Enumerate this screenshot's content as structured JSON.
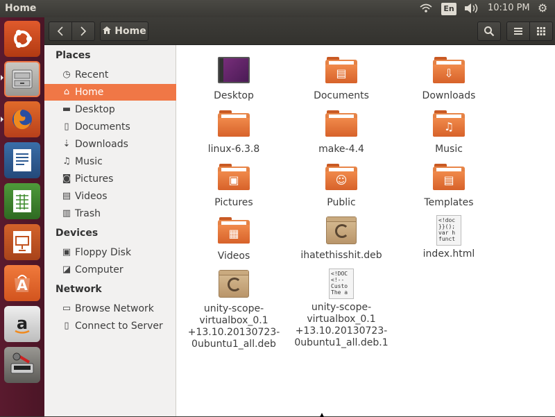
{
  "topbar": {
    "title": "Home",
    "language": "En",
    "clock": "10:10 PM",
    "icons": {
      "network": "wifi-icon",
      "sound": "volume-icon",
      "system": "gear-icon"
    }
  },
  "launcher": {
    "items": [
      {
        "name": "ubuntu-dash-icon",
        "glyph": "◎"
      },
      {
        "name": "files-icon",
        "glyph": "▭"
      },
      {
        "name": "firefox-icon",
        "glyph": "●"
      },
      {
        "name": "libreoffice-writer-icon",
        "glyph": "≡"
      },
      {
        "name": "libreoffice-calc-icon",
        "glyph": "▦"
      },
      {
        "name": "libreoffice-impress-icon",
        "glyph": "▣"
      },
      {
        "name": "software-center-icon",
        "glyph": "A"
      },
      {
        "name": "amazon-icon",
        "glyph": "a"
      },
      {
        "name": "system-settings-icon",
        "glyph": "⚙"
      }
    ]
  },
  "headerbar": {
    "location": "Home",
    "icons": {
      "back": "‹",
      "forward": "›",
      "home": "⌂",
      "search": "⚲",
      "menu": "☰",
      "view": "⋮⋮"
    }
  },
  "sidebar": {
    "sections": [
      {
        "title": "Places",
        "items": [
          {
            "label": "Recent",
            "icon": "◷"
          },
          {
            "label": "Home",
            "icon": "⌂",
            "active": true
          },
          {
            "label": "Desktop",
            "icon": "▬"
          },
          {
            "label": "Documents",
            "icon": "▯"
          },
          {
            "label": "Downloads",
            "icon": "⇣"
          },
          {
            "label": "Music",
            "icon": "♫"
          },
          {
            "label": "Pictures",
            "icon": "◙"
          },
          {
            "label": "Videos",
            "icon": "▤"
          },
          {
            "label": "Trash",
            "icon": "▥"
          }
        ]
      },
      {
        "title": "Devices",
        "items": [
          {
            "label": "Floppy Disk",
            "icon": "▣"
          },
          {
            "label": "Computer",
            "icon": "◪"
          }
        ]
      },
      {
        "title": "Network",
        "items": [
          {
            "label": "Browse Network",
            "icon": "▭"
          },
          {
            "label": "Connect to Server",
            "icon": "▯"
          }
        ]
      }
    ]
  },
  "files": [
    {
      "name": "Desktop",
      "kind": "desktop"
    },
    {
      "name": "Documents",
      "kind": "folder",
      "emblem": "▤"
    },
    {
      "name": "Downloads",
      "kind": "folder",
      "emblem": "⇩"
    },
    {
      "name": "linux-6.3.8",
      "kind": "folder"
    },
    {
      "name": "make-4.4",
      "kind": "folder"
    },
    {
      "name": "Music",
      "kind": "folder",
      "emblem": "♫"
    },
    {
      "name": "Pictures",
      "kind": "folder",
      "emblem": "▣"
    },
    {
      "name": "Public",
      "kind": "folder",
      "emblem": "☺"
    },
    {
      "name": "Templates",
      "kind": "folder",
      "emblem": "▤"
    },
    {
      "name": "Videos",
      "kind": "folder",
      "emblem": "▦"
    },
    {
      "name": "ihatethisshit.deb",
      "kind": "deb"
    },
    {
      "name": "index.html",
      "kind": "doc",
      "preview": "<!doc\n}}();\nvar h\nfunct"
    },
    {
      "name": "unity-scope-virtualbox_0.1+13.10.20130723-0ubuntu1_all.deb",
      "kind": "deb",
      "lines": [
        "unity-scope-",
        "virtualbox_0.1",
        "+13.10.20130723-",
        "0ubuntu1_all.deb"
      ]
    },
    {
      "name": "unity-scope-virtualbox_0.1+13.10.20130723-0ubuntu1_all.deb.1",
      "kind": "doc",
      "preview": "<!DOC\n<!--\nCusto\nThe a",
      "lines": [
        "unity-scope-",
        "virtualbox_0.1",
        "+13.10.20130723-",
        "0ubuntu1_all.deb.1"
      ]
    }
  ],
  "colors": {
    "accent": "#f07746",
    "launcher": "#5a1a2e",
    "panel": "#3c3b37"
  }
}
